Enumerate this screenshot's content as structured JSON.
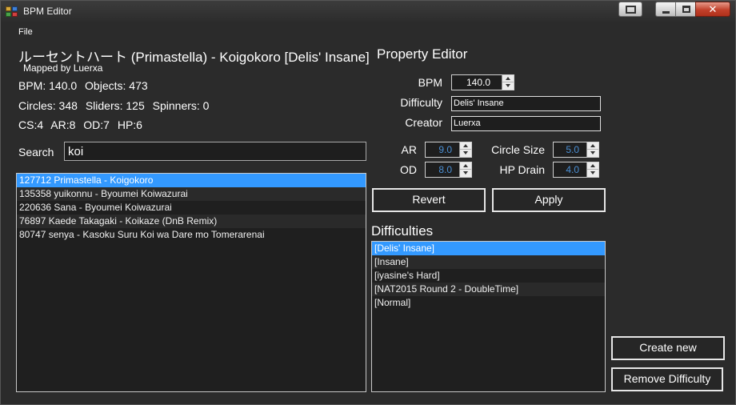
{
  "window": {
    "title": "BPM Editor"
  },
  "menu": {
    "file": "File"
  },
  "song": {
    "title": "ルーセントハート (Primastella) - Koigokoro [Delis' Insane]",
    "mapper": "Mapped by Luerxa",
    "bpm": "BPM: 140.0",
    "objects": "Objects: 473",
    "circles": "Circles: 348",
    "sliders": "Sliders: 125",
    "spinners": "Spinners: 0",
    "cs": "CS:4",
    "ar": "AR:8",
    "od": "OD:7",
    "hp": "HP:6"
  },
  "search": {
    "label": "Search",
    "value": "koi"
  },
  "beatmaps": [
    "127712 Primastella - Koigokoro",
    "135358 yuikonnu - Byoumei Koiwazurai",
    "220636 Sana - Byoumei Koiwazurai",
    "76897 Kaede Takagaki - Koikaze (DnB Remix)",
    "80747 senya - Kasoku Suru Koi wa Dare mo Tomerarenai"
  ],
  "property_editor": {
    "title": "Property Editor",
    "bpm_label": "BPM",
    "bpm_value": "140.0",
    "difficulty_label": "Difficulty",
    "difficulty_value": "Delis' Insane",
    "creator_label": "Creator",
    "creator_value": "Luerxa",
    "ar_label": "AR",
    "ar_value": "9.0",
    "od_label": "OD",
    "od_value": "8.0",
    "cs_label": "Circle Size",
    "cs_value": "5.0",
    "hp_label": "HP Drain",
    "hp_value": "4.0",
    "revert": "Revert",
    "apply": "Apply"
  },
  "difficulties": {
    "title": "Difficulties",
    "items": [
      "[Delis' Insane]",
      "[Insane]",
      "[iyasine's Hard]",
      "[NAT2015 Round 2 - DoubleTime]",
      "[Normal]"
    ]
  },
  "actions": {
    "create_new": "Create new",
    "remove_difficulty": "Remove Difficulty"
  },
  "colors": {
    "selection": "#3399ff",
    "background": "#2b2b2b",
    "dim_value": "#4a8fd4"
  }
}
